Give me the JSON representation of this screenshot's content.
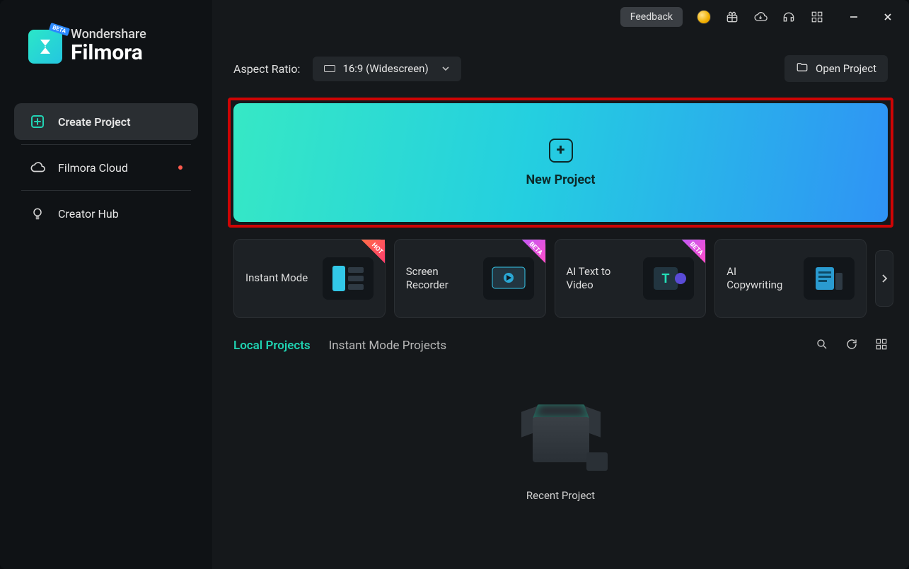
{
  "brand": {
    "top": "Wondershare",
    "bottom": "Filmora",
    "beta": "BETA"
  },
  "sidebar": {
    "items": [
      {
        "label": "Create Project"
      },
      {
        "label": "Filmora Cloud"
      },
      {
        "label": "Creator Hub"
      }
    ]
  },
  "titlebar": {
    "feedback": "Feedback"
  },
  "aspect": {
    "label": "Aspect Ratio:",
    "value": "16:9 (Widescreen)"
  },
  "open_project": "Open Project",
  "new_project": "New Project",
  "cards": [
    {
      "label": "Instant Mode",
      "tag": "HOT"
    },
    {
      "label": "Screen Recorder",
      "tag": "BETA"
    },
    {
      "label": "AI Text to Video",
      "tag": "BETA"
    },
    {
      "label": "AI Copywriting",
      "tag": ""
    }
  ],
  "tabs": {
    "local": "Local Projects",
    "instant": "Instant Mode Projects"
  },
  "empty": {
    "label": "Recent Project"
  }
}
